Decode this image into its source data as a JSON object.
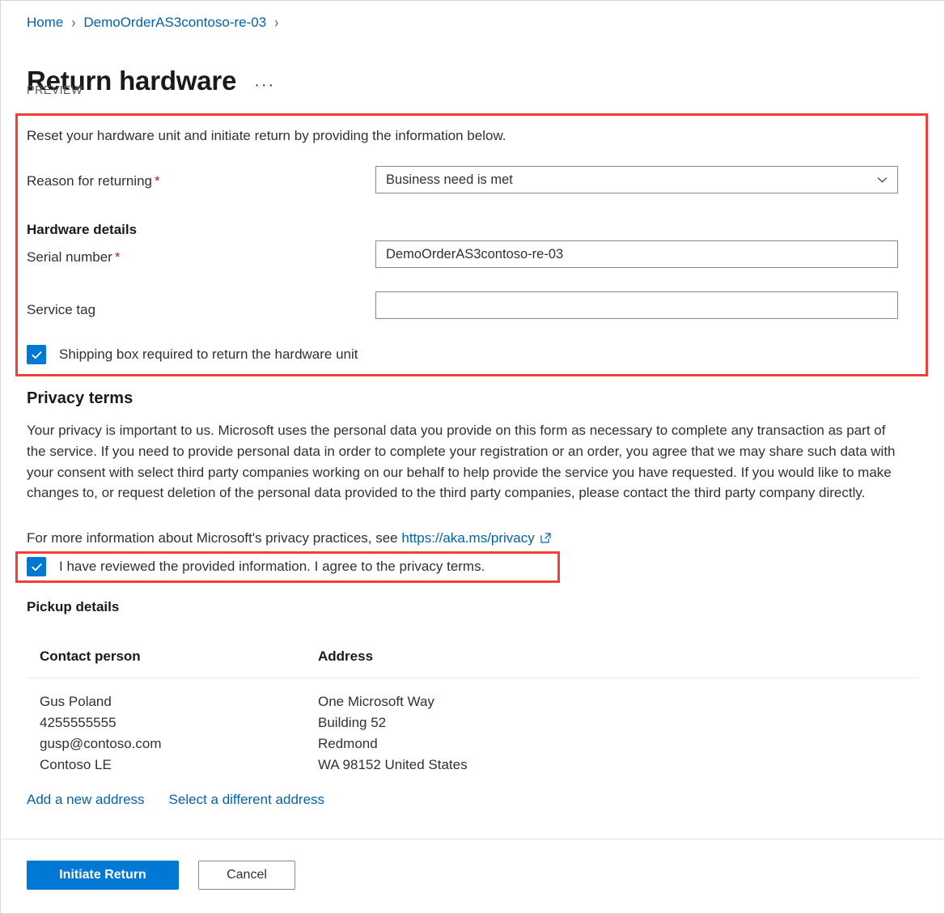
{
  "breadcrumb": {
    "items": [
      {
        "label": "Home"
      },
      {
        "label": "DemoOrderAS3contoso-re-03"
      }
    ],
    "separator": "›"
  },
  "header": {
    "title": "Return hardware",
    "overflow_menu": "···",
    "preview_badge": "PREVIEW"
  },
  "form": {
    "intro": "Reset your hardware unit and initiate return by providing the information below.",
    "reason": {
      "label": "Reason for returning",
      "required_marker": "*",
      "value": "Business need is met"
    },
    "hardware_details_heading": "Hardware details",
    "serial_number": {
      "label": "Serial number",
      "required_marker": "*",
      "value": "DemoOrderAS3contoso-re-03",
      "placeholder": ""
    },
    "service_tag": {
      "label": "Service tag",
      "value": "",
      "placeholder": ""
    },
    "shipping_box_checkbox": {
      "label": "Shipping box required to return the hardware unit",
      "checked": true
    }
  },
  "privacy": {
    "heading": "Privacy terms",
    "body": "Your privacy is important to us. Microsoft uses the personal data you provide on this form as necessary to complete any transaction as part of the service. If you need to provide personal data in order to complete your registration or an order, you agree that we may share such data with your consent with select third party companies working on our behalf to help provide the service you have requested. If you would like to make changes to, or request deletion of the personal data provided to the third party companies, please contact the third party company directly.",
    "more_info_prefix": "For more information about Microsoft's privacy practices, see",
    "link_text": "https://aka.ms/privacy",
    "agree_checkbox": {
      "label": "I have reviewed the provided information. I agree to the privacy terms.",
      "checked": true
    }
  },
  "pickup": {
    "heading": "Pickup details",
    "columns": [
      "Contact person",
      "Address"
    ],
    "contact_person": [
      "Gus Poland",
      "4255555555",
      "gusp@contoso.com",
      "Contoso LE"
    ],
    "address": [
      "One Microsoft Way",
      "Building 52",
      "Redmond",
      "WA 98152 United States"
    ],
    "links": [
      {
        "label": "Add a new address"
      },
      {
        "label": "Select a different address"
      }
    ]
  },
  "footer": {
    "primary_button": "Initiate Return",
    "secondary_button": "Cancel"
  },
  "colors": {
    "accent": "#0078d4",
    "link": "#0063b1",
    "required": "#a4262c",
    "annotation": "#ef4136",
    "border": "#8a8886"
  }
}
